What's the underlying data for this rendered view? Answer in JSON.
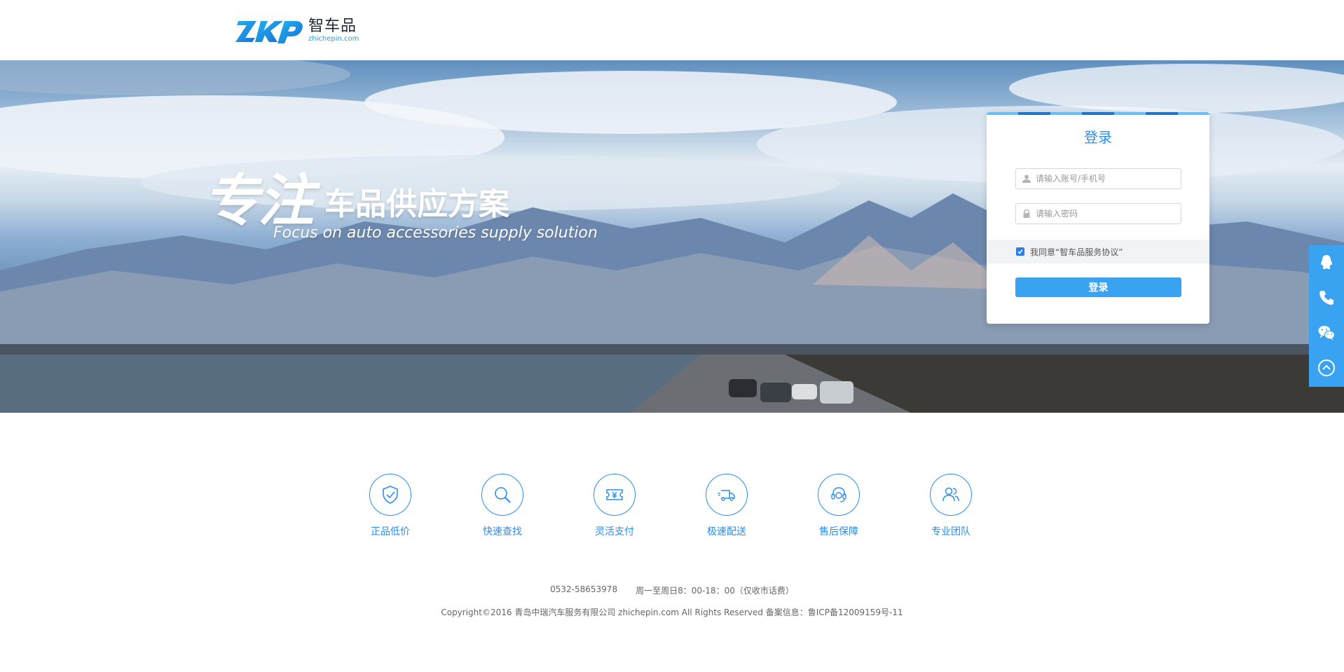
{
  "header": {
    "logo_cn": "智车品",
    "logo_en": "zhichepin.com"
  },
  "banner": {
    "slogan_big": "专注",
    "slogan_mid": "车品供应方案",
    "slogan_en": "Focus on auto accessories supply solution"
  },
  "login": {
    "title": "登录",
    "account_placeholder": "请输入账号/手机号",
    "password_placeholder": "请输入密码",
    "agree_text": "我同意“智车品服务协议”",
    "agree_checked": true,
    "button_label": "登录",
    "accent_color": "#39a3f2"
  },
  "sidebar": {
    "items": [
      {
        "name": "qq-icon"
      },
      {
        "name": "phone-icon"
      },
      {
        "name": "wechat-icon"
      },
      {
        "name": "back-to-top-icon"
      }
    ]
  },
  "features": [
    {
      "label": "正品低价",
      "icon": "shield-check-icon"
    },
    {
      "label": "快速查找",
      "icon": "search-icon"
    },
    {
      "label": "灵活支付",
      "icon": "yuan-ticket-icon"
    },
    {
      "label": "极速配送",
      "icon": "delivery-truck-icon"
    },
    {
      "label": "售后保障",
      "icon": "headset-icon"
    },
    {
      "label": "专业团队",
      "icon": "team-icon"
    }
  ],
  "footer": {
    "phone": "0532-58653978",
    "hours": "周一至周日8：00-18：00（仅收市话费）",
    "copyright": "Copyright©2016 青岛中瑞汽车服务有限公司 zhichepin.com All Rights Reserved 备案信息：鲁ICP备12009159号-11"
  }
}
